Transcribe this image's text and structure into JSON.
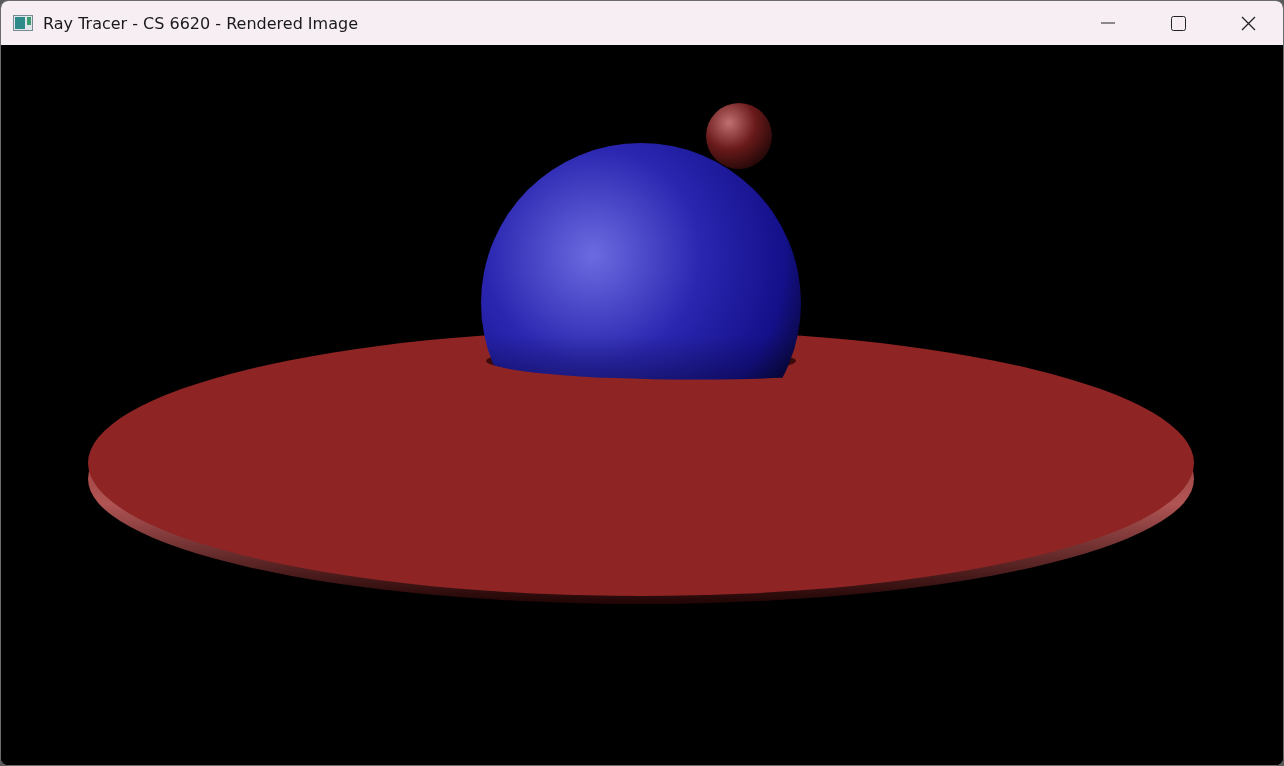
{
  "window": {
    "title": "Ray Tracer - CS 6620 - Rendered Image"
  }
}
